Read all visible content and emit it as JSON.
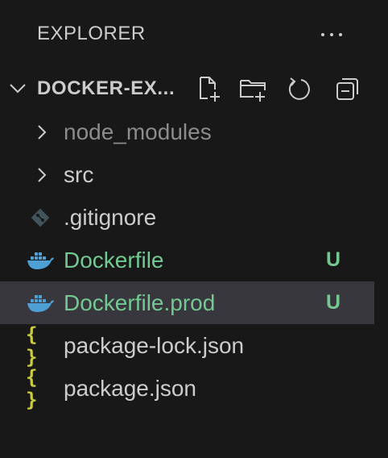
{
  "header": {
    "title": "EXPLORER",
    "more_icon": "ellipsis-icon"
  },
  "folder": {
    "name": "DOCKER-EX...",
    "expanded": true,
    "actions": [
      {
        "icon": "new-file-icon"
      },
      {
        "icon": "new-folder-icon"
      },
      {
        "icon": "refresh-icon"
      },
      {
        "icon": "collapse-all-icon"
      }
    ]
  },
  "colors": {
    "background": "#181818",
    "selected_row": "#37373d",
    "text": "#cccccc",
    "untracked_green": "#73c991",
    "ignored_gray": "#8c8c8c",
    "docker_blue": "#4e9fd4",
    "json_yellow": "#cbcb41",
    "git_icon_gray": "#41535b"
  },
  "tree": [
    {
      "label": "node_modules",
      "type": "folder",
      "status": ""
    },
    {
      "label": "src",
      "type": "folder",
      "status": ""
    },
    {
      "label": ".gitignore",
      "type": "git",
      "status": ""
    },
    {
      "label": "Dockerfile",
      "type": "docker",
      "status": "U"
    },
    {
      "label": "Dockerfile.prod",
      "type": "docker",
      "status": "U",
      "selected": true
    },
    {
      "label": "package-lock.json",
      "type": "json",
      "status": "",
      "icon_text": "{ }"
    },
    {
      "label": "package.json",
      "type": "json",
      "status": "",
      "icon_text": "{ }"
    }
  ]
}
